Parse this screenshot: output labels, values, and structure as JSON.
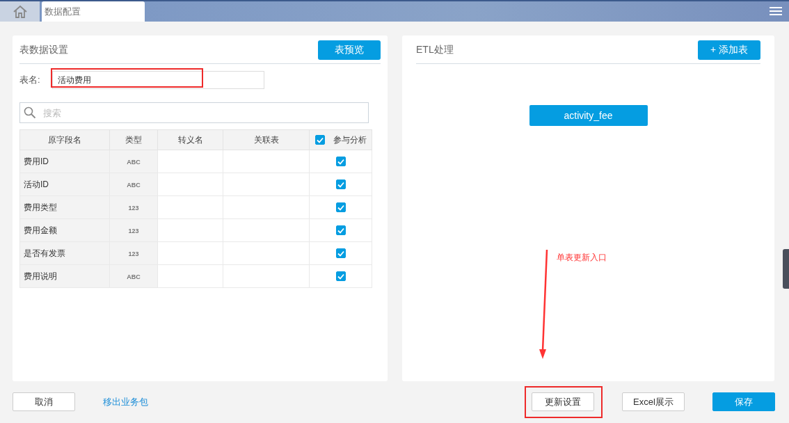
{
  "top_bar": {
    "tabs": [
      {
        "kind": "home",
        "selected": false
      },
      {
        "kind": "text",
        "label": "数据配置",
        "selected": true
      }
    ]
  },
  "left_panel": {
    "title": "表数据设置",
    "preview_button": "表预览",
    "table_name": {
      "label": "表名:",
      "value": "活动费用",
      "highlighted": true
    },
    "search": {
      "placeholder": "搜索"
    },
    "table": {
      "columns": [
        "原字段名",
        "类型",
        "转义名",
        "关联表",
        "参与分析"
      ],
      "all_checked": true,
      "rows": [
        {
          "field": "费用ID",
          "type": "ABC",
          "checked": true
        },
        {
          "field": "活动ID",
          "type": "ABC",
          "checked": true
        },
        {
          "field": "费用类型",
          "type": "123",
          "checked": true
        },
        {
          "field": "费用金额",
          "type": "123",
          "checked": true
        },
        {
          "field": "是否有发票",
          "type": "123",
          "checked": true
        },
        {
          "field": "费用说明",
          "type": "ABC",
          "checked": true
        }
      ]
    }
  },
  "right_panel": {
    "title": "ETL处理",
    "add_button": "+ 添加表",
    "nodes": [
      {
        "label": "activity_fee"
      }
    ],
    "annotation": "单表更新入口"
  },
  "footer": {
    "cancel": "取消",
    "link": "移出业务包",
    "buttons": [
      {
        "label": "更新设置",
        "kind": "default",
        "highlighted": true
      },
      {
        "label": "Excel展示",
        "kind": "default",
        "highlighted": false
      },
      {
        "label": "保存",
        "kind": "primary",
        "highlighted": false
      }
    ]
  }
}
